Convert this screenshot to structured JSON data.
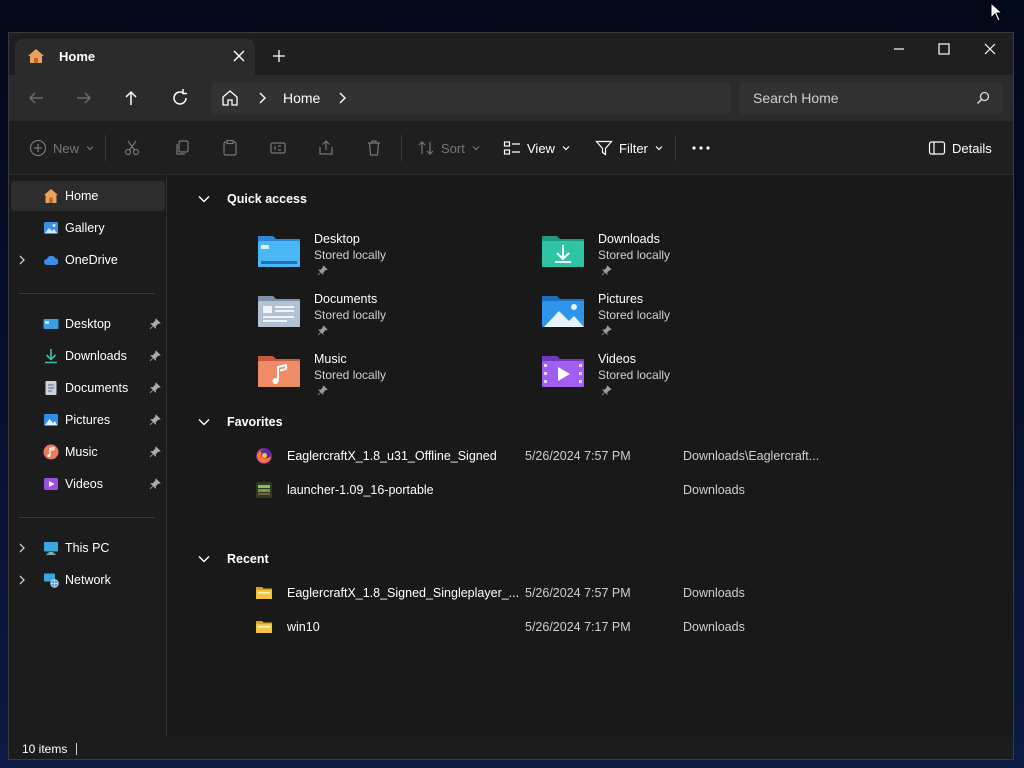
{
  "tab": {
    "title": "Home"
  },
  "nav": {
    "breadcrumb": [
      "Home"
    ],
    "search_placeholder": "Search Home"
  },
  "commands": {
    "new": "New",
    "sort": "Sort",
    "view": "View",
    "filter": "Filter",
    "details": "Details"
  },
  "sidebar": {
    "top": [
      {
        "label": "Home",
        "icon": "home-icon",
        "active": true
      },
      {
        "label": "Gallery",
        "icon": "gallery-icon"
      },
      {
        "label": "OneDrive",
        "icon": "cloud-icon",
        "expandable": true
      }
    ],
    "pinned": [
      {
        "label": "Desktop",
        "icon": "desktop-icon"
      },
      {
        "label": "Downloads",
        "icon": "downloads-icon"
      },
      {
        "label": "Documents",
        "icon": "documents-icon"
      },
      {
        "label": "Pictures",
        "icon": "pictures-icon"
      },
      {
        "label": "Music",
        "icon": "music-icon"
      },
      {
        "label": "Videos",
        "icon": "videos-icon"
      }
    ],
    "bottom": [
      {
        "label": "This PC",
        "icon": "computer-icon",
        "expandable": true
      },
      {
        "label": "Network",
        "icon": "network-icon",
        "expandable": true
      }
    ]
  },
  "sections": {
    "quick_access": "Quick access",
    "favorites": "Favorites",
    "recent": "Recent"
  },
  "quick_access": [
    {
      "name": "Desktop",
      "status": "Stored locally"
    },
    {
      "name": "Downloads",
      "status": "Stored locally"
    },
    {
      "name": "Documents",
      "status": "Stored locally"
    },
    {
      "name": "Pictures",
      "status": "Stored locally"
    },
    {
      "name": "Music",
      "status": "Stored locally"
    },
    {
      "name": "Videos",
      "status": "Stored locally"
    }
  ],
  "favorites": [
    {
      "name": "EaglercraftX_1.8_u31_Offline_Signed",
      "date": "5/26/2024 7:57 PM",
      "location": "Downloads\\Eaglercraft..."
    },
    {
      "name": "launcher-1.09_16-portable",
      "date": "",
      "location": "Downloads"
    }
  ],
  "recent": [
    {
      "name": "EaglercraftX_1.8_Signed_Singleplayer_...",
      "date": "5/26/2024 7:57 PM",
      "location": "Downloads"
    },
    {
      "name": "win10",
      "date": "5/26/2024 7:17 PM",
      "location": "Downloads"
    }
  ],
  "status": {
    "item_count": "10 items"
  },
  "colors": {
    "background": "#191919",
    "folder_yellow": "#f5c542",
    "accent": "#4aa0f0"
  }
}
